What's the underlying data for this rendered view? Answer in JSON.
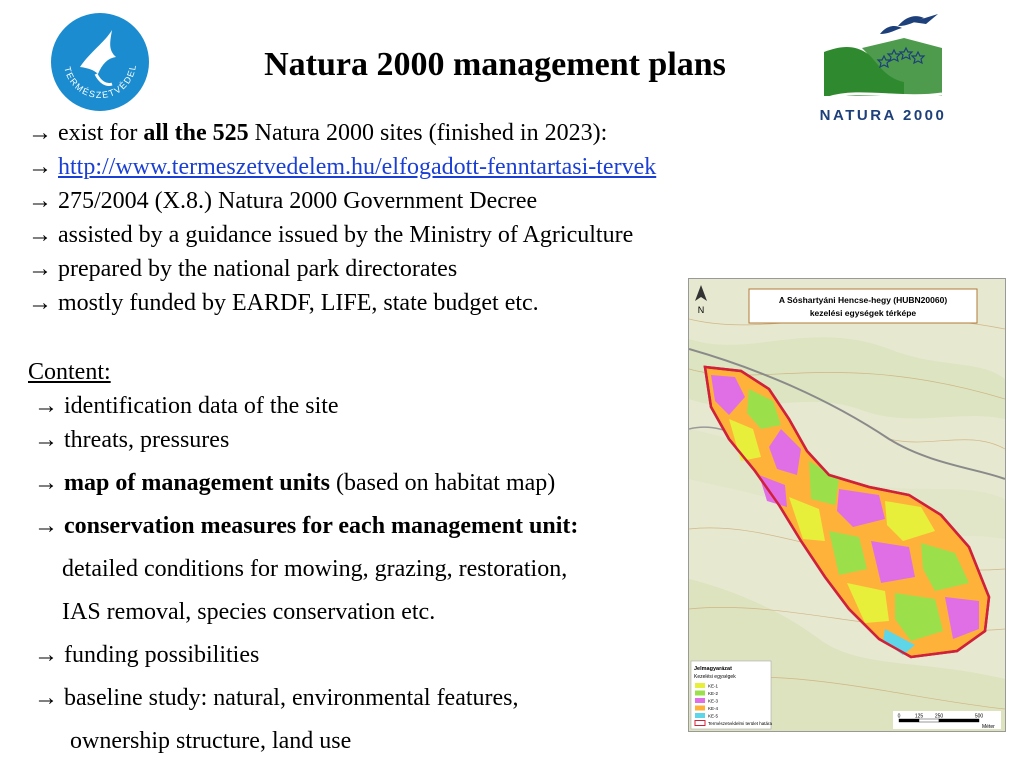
{
  "slide": {
    "title": "Natura 2000 management plans",
    "bullet_arrow": "→",
    "lines": [
      {
        "pre": " exist for ",
        "bold": "all the 525",
        "post": " Natura 2000 sites (finished in 2023):"
      },
      {
        "link": "http://www.termeszetvedelem.hu/elfogadott-fenntartasi-tervek"
      },
      {
        "text": "275/2004 (X.8.) Natura 2000 Government Decree"
      },
      {
        "text": "assisted by a guidance issued by the Ministry of Agriculture"
      },
      {
        "text": "prepared by the national park directorates"
      },
      {
        "text": "mostly funded by EARDF, LIFE, state budget etc."
      }
    ],
    "content_heading": "Content:",
    "content": [
      {
        "text": "identification data of the site"
      },
      {
        "text": "threats, pressures"
      },
      {
        "bold": "map of management units",
        "post": " (based on habitat map)"
      },
      {
        "bold": "conservation measures for each management unit:"
      },
      {
        "cont": "detailed conditions for mowing, grazing, restoration,"
      },
      {
        "cont": "IAS removal, species conservation etc."
      },
      {
        "text": "funding possibilities"
      },
      {
        "text": "baseline study: natural, environmental features,"
      },
      {
        "cont": "ownership structure, land use"
      }
    ]
  },
  "logo_left": {
    "text": "TERMÉSZETVÉDELEM",
    "color": "#1b8ccf"
  },
  "logo_right": {
    "text": "NATURA 2000",
    "green": "#2f8a2f",
    "blue": "#1d3f7a"
  },
  "map": {
    "title_line1": "A Sóshartyáni Hencse-hegy (HUBN20060)",
    "title_line2": "kezelési egységek térképe",
    "north": "N",
    "legend_title": "Jelmagyarázat",
    "legend_subtitle": "Kezelési egységek",
    "legend_items": [
      {
        "label": "KE-1",
        "color": "#e7ef3a"
      },
      {
        "label": "KE-2",
        "color": "#9be04a"
      },
      {
        "label": "KE-3",
        "color": "#e06fe6"
      },
      {
        "label": "KE-4",
        "color": "#ffb23a"
      },
      {
        "label": "KE-5",
        "color": "#5fd6e8"
      },
      {
        "label": "Természetvédelmi terület határa",
        "color": "#d0213a"
      }
    ],
    "scale_ticks": [
      "0",
      "125",
      "250",
      "500"
    ],
    "scale_unit": "Méter"
  }
}
